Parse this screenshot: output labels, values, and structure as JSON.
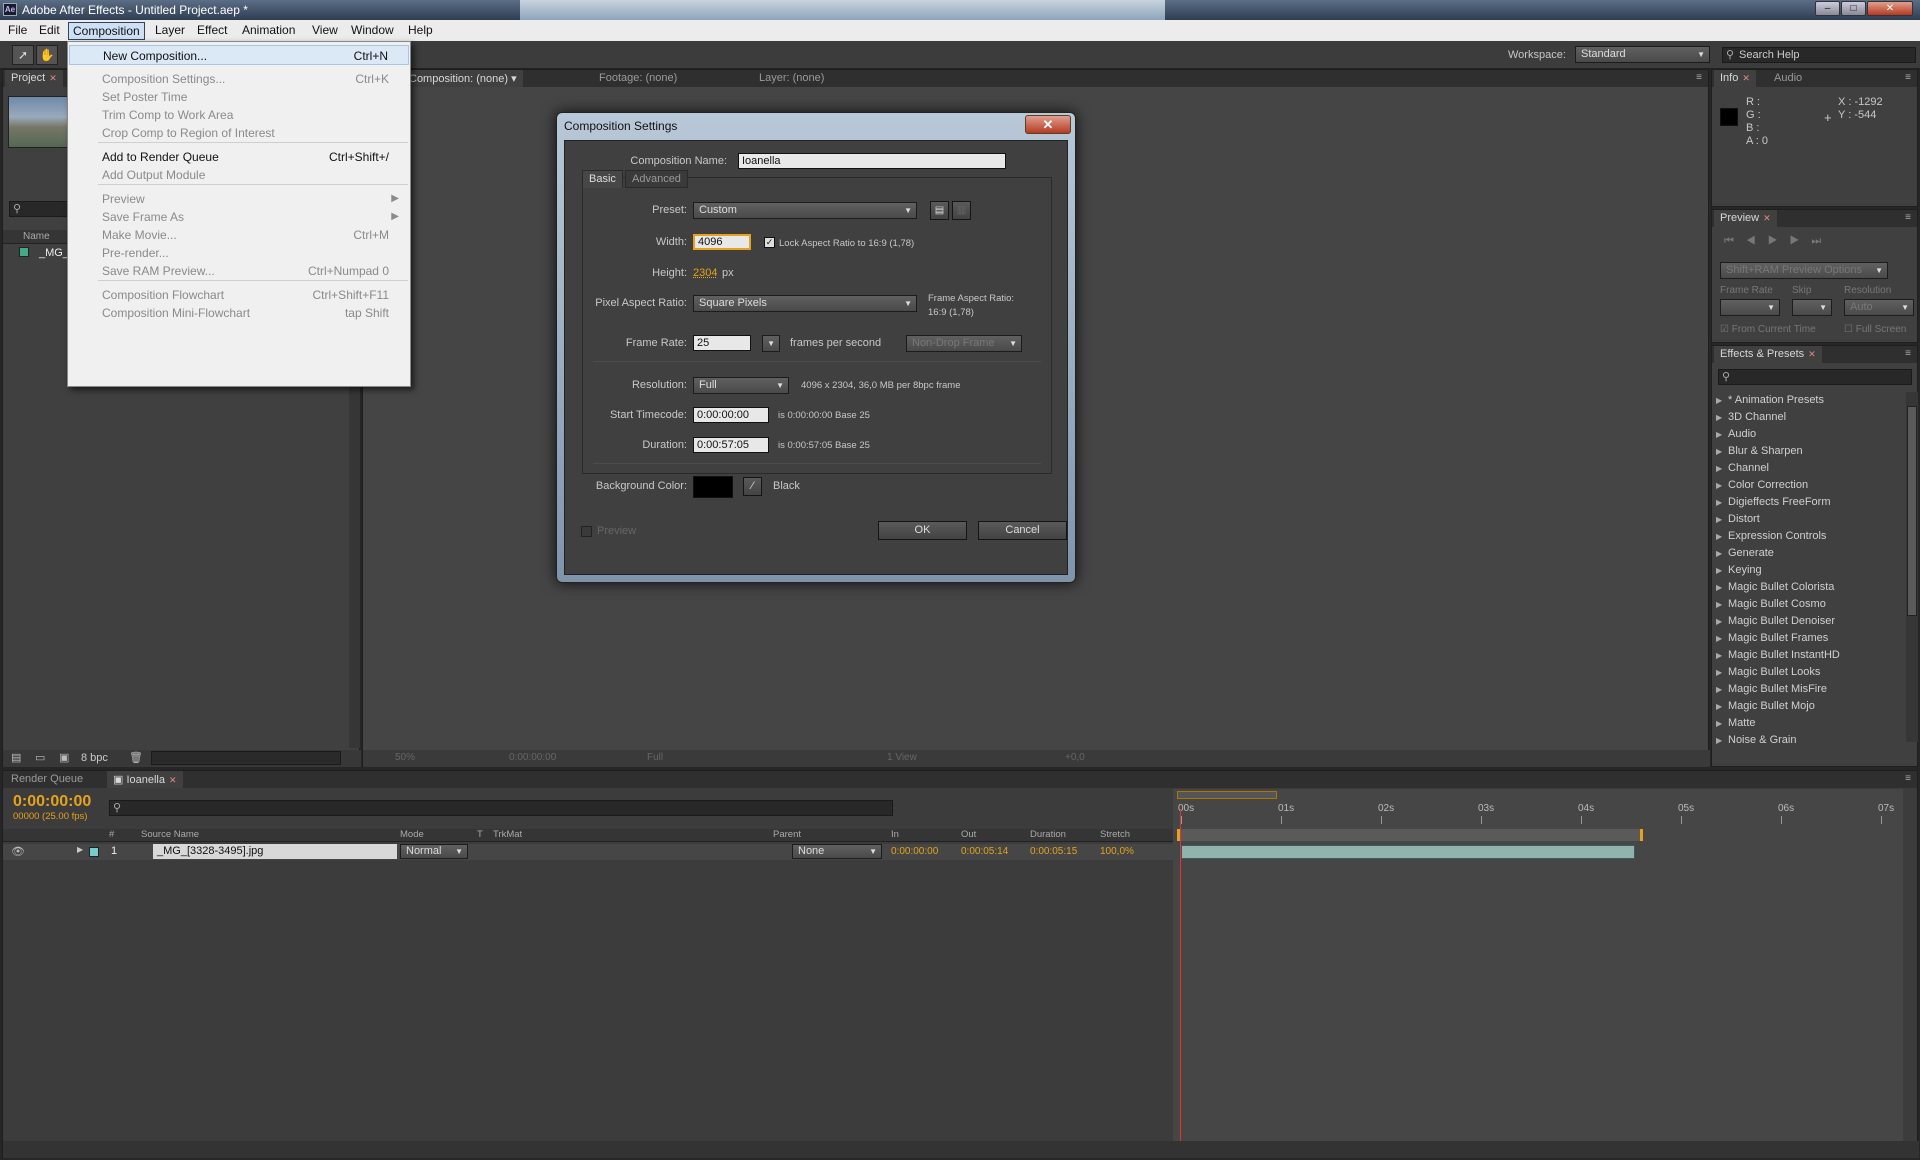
{
  "window": {
    "title": "Adobe After Effects - Untitled Project.aep *",
    "app_icon": "Ae"
  },
  "menubar": [
    "File",
    "Edit",
    "Composition",
    "Layer",
    "Effect",
    "Animation",
    "View",
    "Window",
    "Help"
  ],
  "toolbar": {
    "workspace_label": "Workspace:",
    "workspace_value": "Standard",
    "search_help": "Search Help"
  },
  "composition_menu": [
    {
      "label": "New Composition...",
      "shortcut": "Ctrl+N",
      "enabled": true
    },
    {
      "label": "Composition Settings...",
      "shortcut": "Ctrl+K",
      "enabled": false
    },
    {
      "label": "Set Poster Time",
      "shortcut": "",
      "enabled": false
    },
    {
      "label": "Trim Comp to Work Area",
      "shortcut": "",
      "enabled": false
    },
    {
      "label": "Crop Comp to Region of Interest",
      "shortcut": "",
      "enabled": false
    },
    {
      "label": "Add to Render Queue",
      "shortcut": "Ctrl+Shift+/",
      "enabled": true
    },
    {
      "label": "Add Output Module",
      "shortcut": "",
      "enabled": false
    },
    {
      "label": "Preview",
      "shortcut": "",
      "enabled": false,
      "submenu": true
    },
    {
      "label": "Save Frame As",
      "shortcut": "",
      "enabled": false,
      "submenu": true
    },
    {
      "label": "Make Movie...",
      "shortcut": "Ctrl+M",
      "enabled": false
    },
    {
      "label": "Pre-render...",
      "shortcut": "",
      "enabled": false
    },
    {
      "label": "Save RAM Preview...",
      "shortcut": "Ctrl+Numpad 0",
      "enabled": false
    },
    {
      "label": "Composition Flowchart",
      "shortcut": "Ctrl+Shift+F11",
      "enabled": false
    },
    {
      "label": "Composition Mini-Flowchart",
      "shortcut": "tap Shift",
      "enabled": false
    }
  ],
  "project_panel": {
    "tab": "Project",
    "col_name": "Name",
    "item": "_MG_",
    "bpc": "8 bpc"
  },
  "comp_panel": {
    "tabs": [
      "Composition: (none)",
      "Footage: (none)",
      "Layer: (none)"
    ],
    "zoom": "50%",
    "timecode": "0:00:00:00",
    "resolution": "Full",
    "views": "1 View",
    "exposure": "+0,0"
  },
  "dialog": {
    "title": "Composition Settings",
    "name_label": "Composition Name:",
    "name_value": "Ioanella",
    "tabs": [
      "Basic",
      "Advanced"
    ],
    "preset_label": "Preset:",
    "preset_value": "Custom",
    "width_label": "Width:",
    "width_value": "4096",
    "lock_label": "Lock Aspect Ratio to 16:9 (1,78)",
    "height_label": "Height:",
    "height_value": "2304",
    "px": "px",
    "par_label": "Pixel Aspect Ratio:",
    "par_value": "Square Pixels",
    "far_label": "Frame Aspect Ratio:",
    "far_value": "16:9 (1,78)",
    "fps_label": "Frame Rate:",
    "fps_value": "25",
    "fps_unit": "frames per second",
    "drop_frame": "Non-Drop Frame",
    "res_label": "Resolution:",
    "res_value": "Full",
    "res_info": "4096 x 2304, 36,0 MB per 8bpc frame",
    "start_label": "Start Timecode:",
    "start_value": "0:00:00:00",
    "start_info": "is 0:00:00:00  Base 25",
    "dur_label": "Duration:",
    "dur_value": "0:00:57:05",
    "dur_info": "is 0:00:57:05  Base 25",
    "bg_label": "Background Color:",
    "bg_name": "Black",
    "bg_color": "#000000",
    "preview_label": "Preview",
    "ok": "OK",
    "cancel": "Cancel"
  },
  "info_panel": {
    "tabs": [
      "Info",
      "Audio"
    ],
    "r": "R :",
    "g": "G :",
    "b": "B :",
    "a": "A : 0",
    "x": "X : -1292",
    "y": "Y : -544"
  },
  "preview_panel": {
    "tab": "Preview",
    "options": "Shift+RAM Preview Options",
    "frame_rate": "Frame Rate",
    "skip": "Skip",
    "resolution": "Resolution",
    "auto": "Auto",
    "from_current": "From Current Time",
    "full_screen": "Full Screen"
  },
  "effects_panel": {
    "tab": "Effects & Presets",
    "items": [
      "* Animation Presets",
      "3D Channel",
      "Audio",
      "Blur & Sharpen",
      "Channel",
      "Color Correction",
      "Digieffects FreeForm",
      "Distort",
      "Expression Controls",
      "Generate",
      "Keying",
      "Magic Bullet Colorista",
      "Magic Bullet Cosmo",
      "Magic Bullet Denoiser",
      "Magic Bullet Frames",
      "Magic Bullet InstantHD",
      "Magic Bullet Looks",
      "Magic Bullet MisFire",
      "Magic Bullet Mojo",
      "Matte",
      "Noise & Grain"
    ]
  },
  "timeline": {
    "tabs": [
      "Render Queue",
      "Ioanella"
    ],
    "timecode": "0:00:00:00",
    "fps_info": "00000 (25.00 fps)",
    "columns": [
      "#",
      "Source Name",
      "Mode",
      "T",
      "TrkMat",
      "Parent",
      "In",
      "Out",
      "Duration",
      "Stretch"
    ],
    "layer": {
      "num": "1",
      "name": "_MG_[3328-3495].jpg",
      "mode": "Normal",
      "parent": "None",
      "in": "0:00:00:00",
      "out": "0:00:05:14",
      "duration": "0:00:05:15",
      "stretch": "100,0%"
    },
    "ruler": [
      "00s",
      "01s",
      "02s",
      "03s",
      "04s",
      "05s",
      "06s",
      "07s"
    ]
  },
  "colors": {
    "accent": "#e4a31b",
    "panel": "#404040",
    "bg": "#262626",
    "layer_bar": "#8eb4ad",
    "playhead": "#d33"
  }
}
